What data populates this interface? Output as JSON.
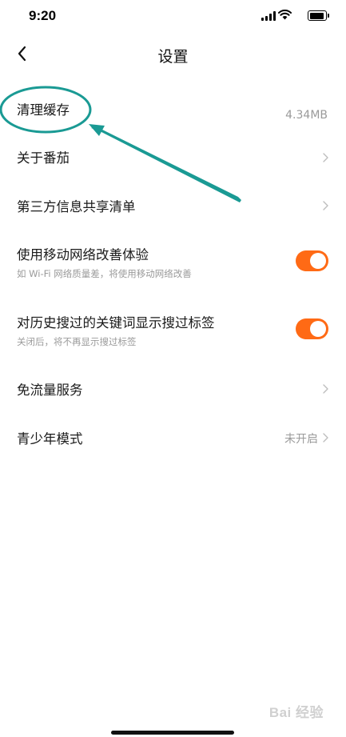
{
  "status_bar": {
    "time": "9:20"
  },
  "nav": {
    "title": "设置"
  },
  "settings": {
    "clear_cache": {
      "label": "清理缓存",
      "value": "4.34MB"
    },
    "about": {
      "label": "关于番茄"
    },
    "third_party": {
      "label": "第三方信息共享清单"
    },
    "mobile_network": {
      "label": "使用移动网络改善体验",
      "sub": "如 Wi-Fi 网络质量差，将使用移动网络改善",
      "enabled": true
    },
    "search_tags": {
      "label": "对历史搜过的关键词显示搜过标签",
      "sub": "关闭后，将不再显示搜过标签",
      "enabled": true
    },
    "free_data": {
      "label": "免流量服务"
    },
    "teen_mode": {
      "label": "青少年模式",
      "value": "未开启"
    }
  },
  "watermark": "Bai 经验",
  "colors": {
    "toggle_on": "#ff6a15",
    "annotation": "#1a9a94",
    "secondary_text": "#9a9a9a"
  }
}
